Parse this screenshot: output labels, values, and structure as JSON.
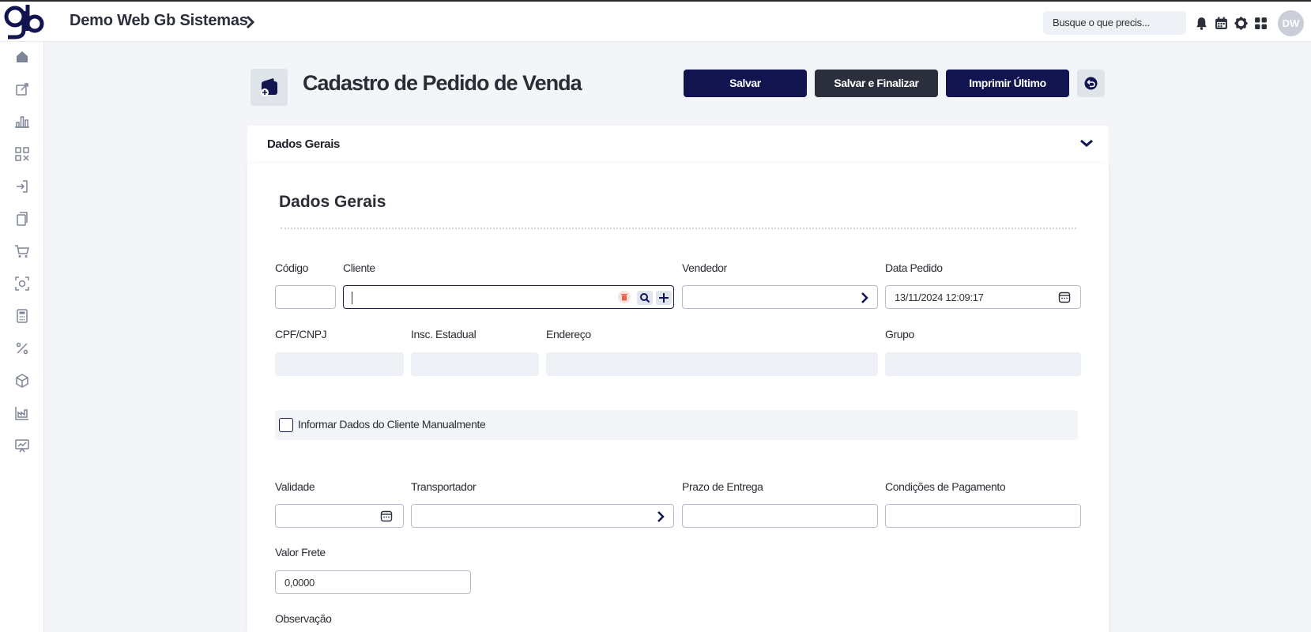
{
  "topbar": {
    "app_title": "Demo Web Gb Sistemas",
    "search_placeholder": "Busque o que precis...",
    "avatar_initials": "DW",
    "icons": [
      "bell-icon",
      "calendar-icon",
      "gear-icon",
      "apps-grid-icon"
    ]
  },
  "sidebar": {
    "items": [
      "home-icon",
      "edit-icon",
      "bar-chart-icon",
      "qr-scan-icon",
      "login-icon",
      "copy-icon",
      "cart-icon",
      "camera-scan-icon",
      "calculator-icon",
      "percent-icon",
      "box-icon",
      "factory-chart-icon",
      "presentation-icon"
    ]
  },
  "header": {
    "title": "Cadastro de Pedido de Venda",
    "buttons": {
      "save": "Salvar",
      "save_finish": "Salvar e Finalizar",
      "print_last": "Imprimir Último"
    }
  },
  "accordion": {
    "label": "Dados Gerais"
  },
  "form": {
    "section_title": "Dados Gerais",
    "labels": {
      "codigo": "Código",
      "cliente": "Cliente",
      "vendedor": "Vendedor",
      "data_pedido": "Data Pedido",
      "cpf_cnpj": "CPF/CNPJ",
      "insc_estadual": "Insc. Estadual",
      "endereco": "Endereço",
      "grupo": "Grupo",
      "validade": "Validade",
      "transportador": "Transportador",
      "prazo_entrega": "Prazo de Entrega",
      "condicoes_pagamento": "Condições de Pagamento",
      "valor_frete": "Valor Frete",
      "observacao": "Observação"
    },
    "values": {
      "codigo": "",
      "cliente": "",
      "vendedor": "",
      "data_pedido": "13/11/2024 12:09:17",
      "validade": "",
      "transportador": "",
      "prazo_entrega": "",
      "condicoes_pagamento": "",
      "valor_frete": "0,0000"
    },
    "manual_client_label": "Informar Dados do Cliente Manualmente",
    "manual_client_checked": false
  },
  "colors": {
    "navy": "#11144f",
    "dark": "#2b2f3c",
    "delete_red": "#e8604c"
  }
}
